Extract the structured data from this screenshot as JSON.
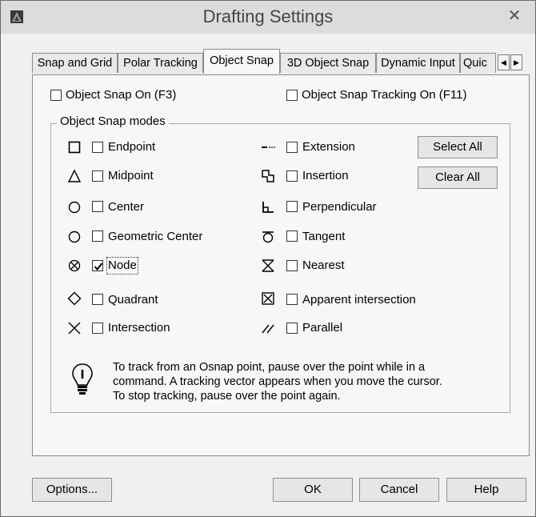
{
  "window": {
    "title": "Drafting Settings",
    "close_glyph": "✕"
  },
  "tabs": [
    {
      "label": "Snap and Grid",
      "active": false
    },
    {
      "label": "Polar Tracking",
      "active": false
    },
    {
      "label": "Object Snap",
      "active": true
    },
    {
      "label": "3D Object Snap",
      "active": false
    },
    {
      "label": "Dynamic Input",
      "active": false
    },
    {
      "label": "Quic",
      "active": false
    }
  ],
  "tab_scroll": {
    "left_glyph": "◀",
    "right_glyph": "▶"
  },
  "top_options": {
    "snap_on": {
      "label": "Object Snap On (F3)",
      "checked": false
    },
    "tracking_on": {
      "label": "Object Snap Tracking On (F11)",
      "checked": false
    }
  },
  "group": {
    "legend": "Object Snap modes"
  },
  "modes_left": [
    {
      "label": "Endpoint",
      "icon": "endpoint-icon",
      "checked": false
    },
    {
      "label": "Midpoint",
      "icon": "midpoint-icon",
      "checked": false
    },
    {
      "label": "Center",
      "icon": "center-icon",
      "checked": false
    },
    {
      "label": "Geometric Center",
      "icon": "geometric-center-icon",
      "checked": false
    },
    {
      "label": "Node",
      "icon": "node-icon",
      "checked": true
    },
    {
      "label": "Quadrant",
      "icon": "quadrant-icon",
      "checked": false
    },
    {
      "label": "Intersection",
      "icon": "intersection-icon",
      "checked": false
    }
  ],
  "modes_right": [
    {
      "label": "Extension",
      "icon": "extension-icon",
      "checked": false
    },
    {
      "label": "Insertion",
      "icon": "insertion-icon",
      "checked": false
    },
    {
      "label": "Perpendicular",
      "icon": "perpendicular-icon",
      "checked": false
    },
    {
      "label": "Tangent",
      "icon": "tangent-icon",
      "checked": false
    },
    {
      "label": "Nearest",
      "icon": "nearest-icon",
      "checked": false
    },
    {
      "label": "Apparent intersection",
      "icon": "apparent-intersection-icon",
      "checked": false
    },
    {
      "label": "Parallel",
      "icon": "parallel-icon",
      "checked": false
    }
  ],
  "buttons": {
    "select_all": "Select All",
    "clear_all": "Clear All",
    "options": "Options...",
    "ok": "OK",
    "cancel": "Cancel",
    "help": "Help"
  },
  "hint": {
    "icon": "lightbulb-icon",
    "lines": [
      "To track from an Osnap point, pause over the point while in a",
      "command.  A tracking vector appears when you move the cursor.",
      "To stop tracking, pause over the point again."
    ]
  }
}
